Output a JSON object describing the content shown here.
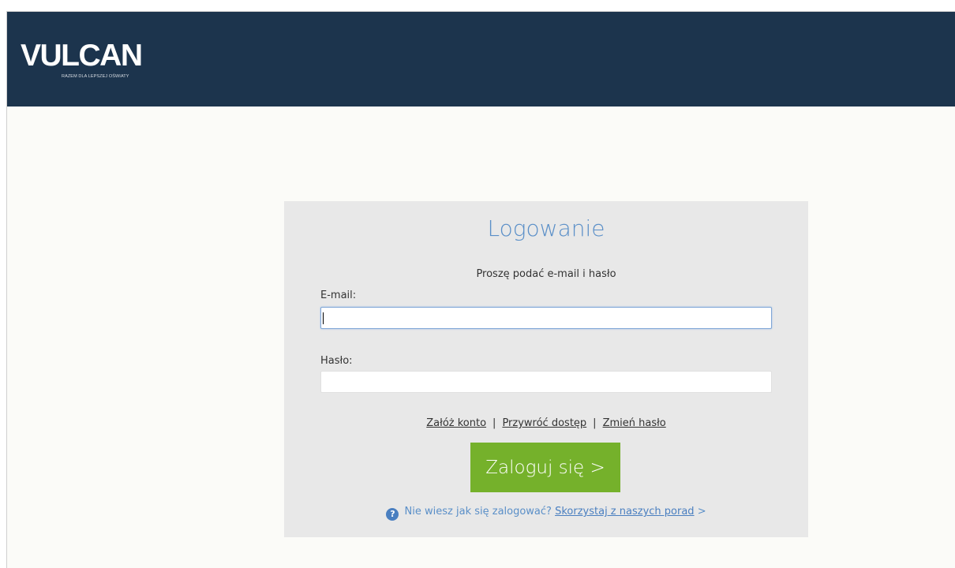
{
  "header": {
    "logo_text": "ULCAN",
    "logo_initial": "V",
    "tagline": "RAZEM DLA LEPSZEJ OŚWIATY"
  },
  "login": {
    "title": "Logowanie",
    "subtitle": "Proszę podać e-mail i hasło",
    "email_label": "E-mail:",
    "email_value": "",
    "password_label": "Hasło:",
    "password_value": "",
    "links": {
      "create_account": "Załóż konto",
      "restore_access": "Przywróć dostęp",
      "change_password": "Zmień hasło",
      "separator": "|"
    },
    "submit_label": "Zaloguj się >",
    "help": {
      "icon": "?",
      "question": "Nie wiesz jak się zalogować?",
      "link": "Skorzystaj z naszych porad",
      "arrow": ">"
    }
  },
  "colors": {
    "header_bg": "#1c344d",
    "panel_bg": "#e8e8e8",
    "title": "#5a8fc8",
    "button_green": "#75b12b",
    "link_blue": "#4a7fc0"
  }
}
